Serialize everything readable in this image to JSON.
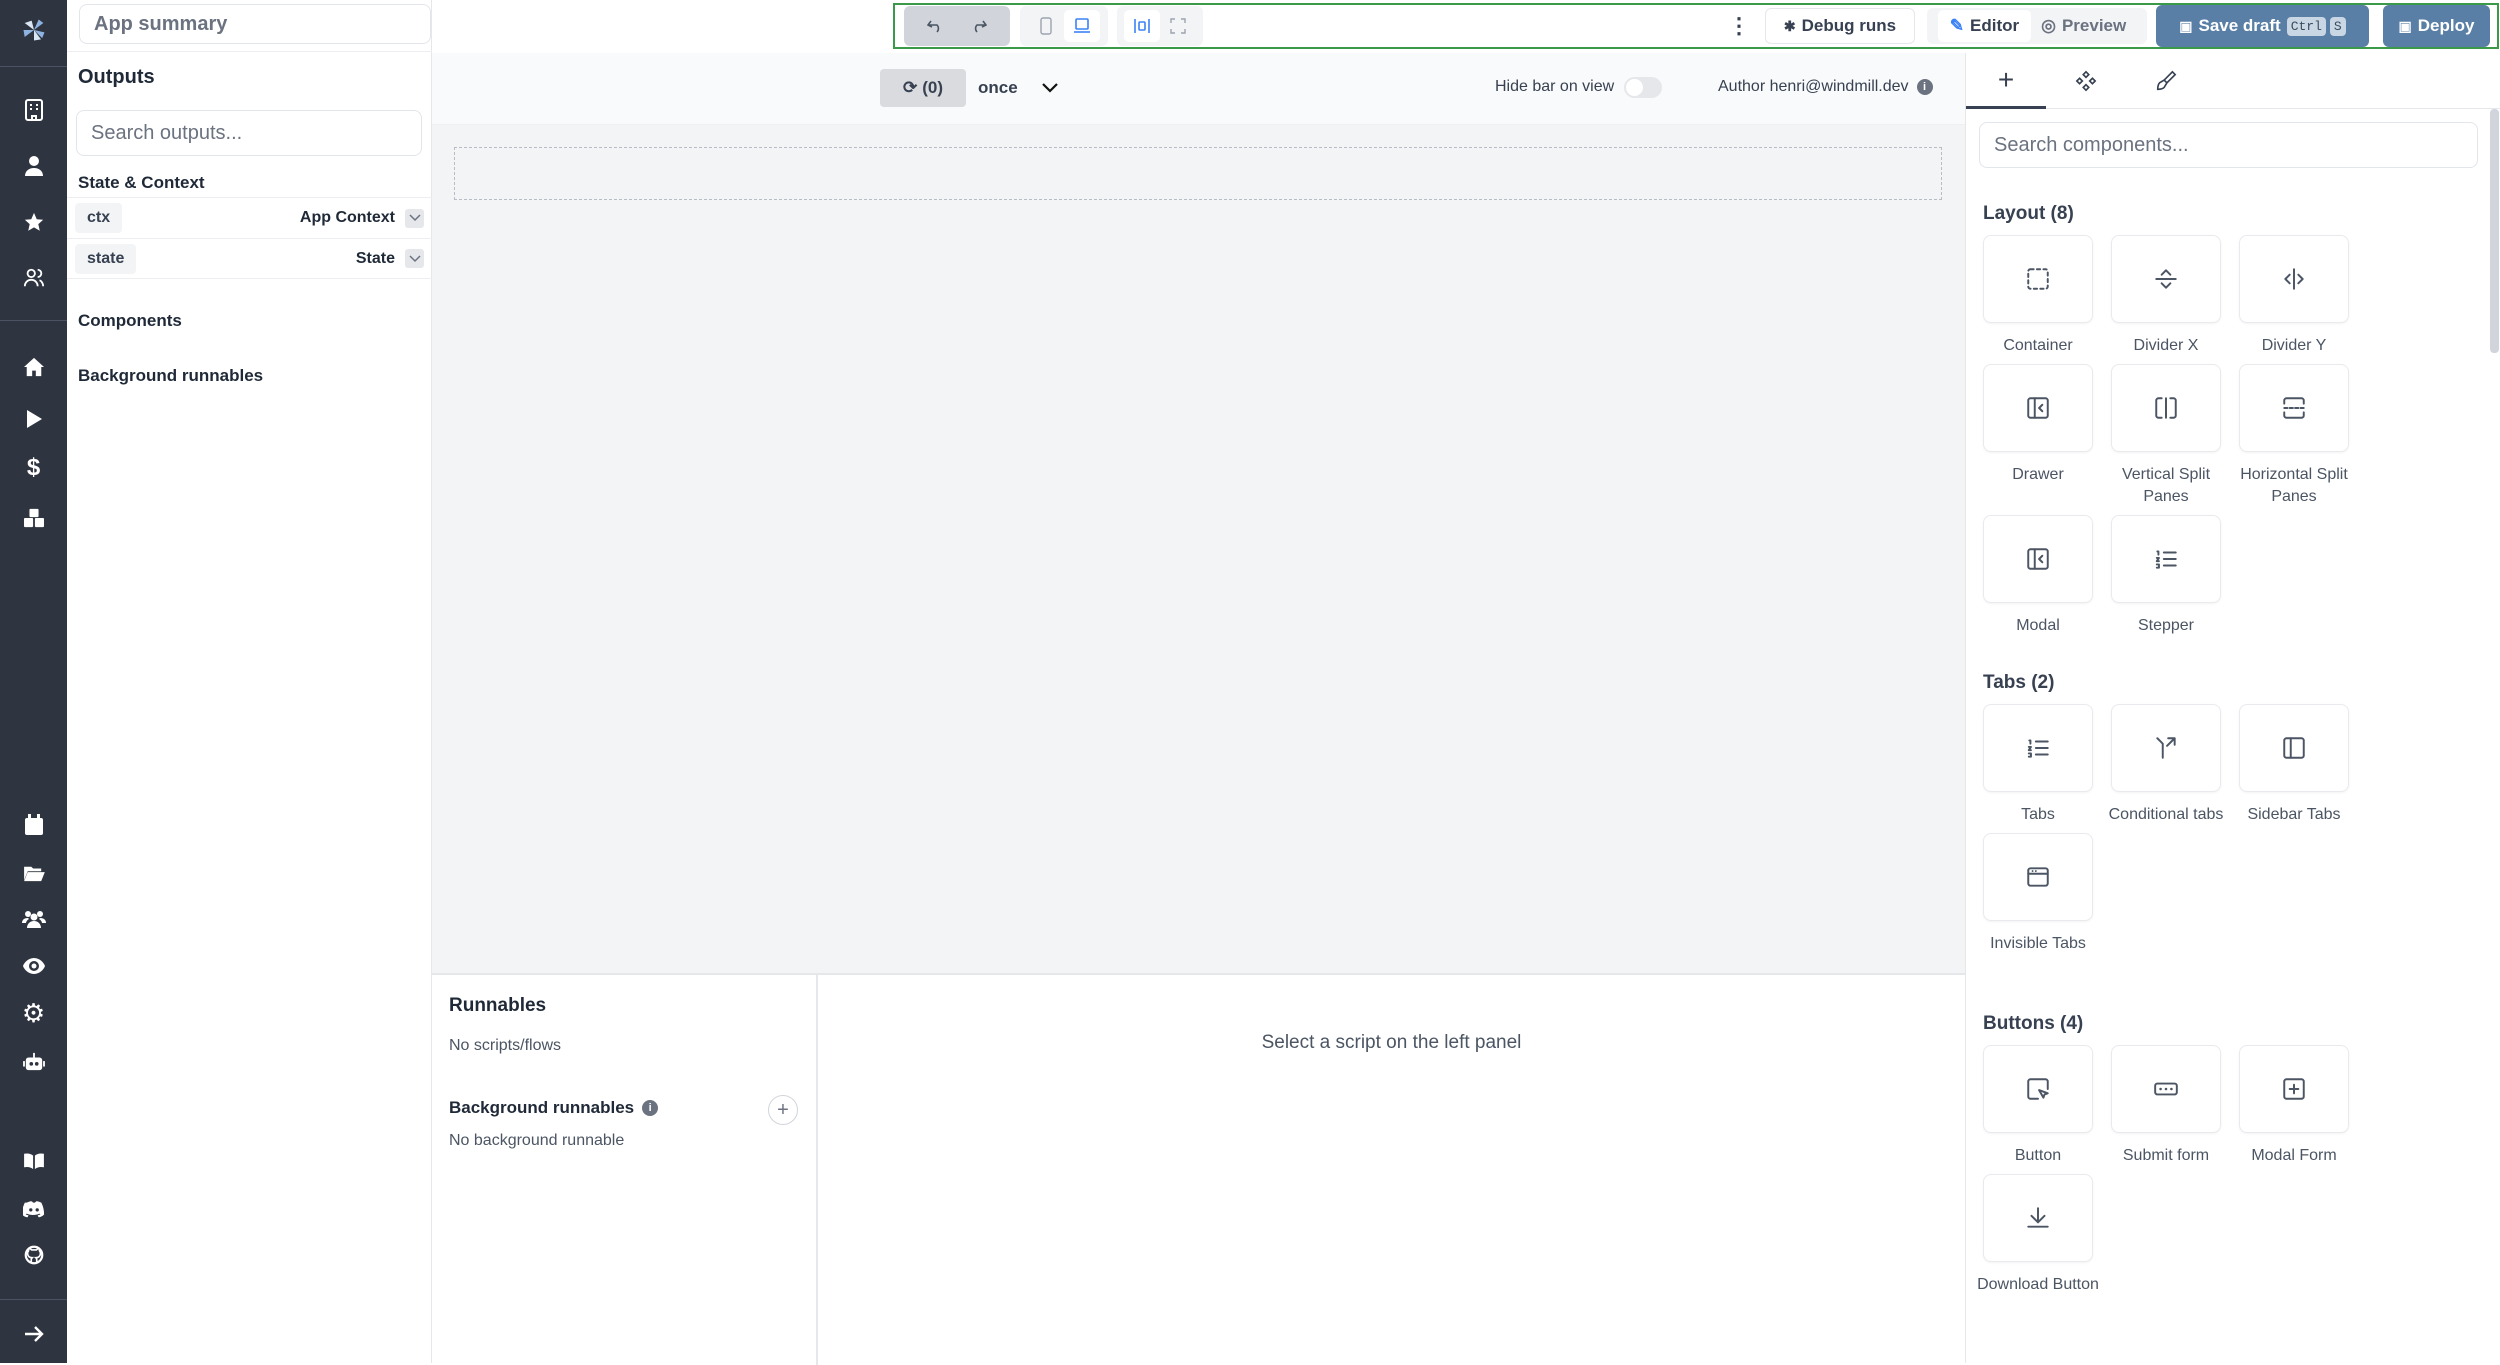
{
  "app_title_placeholder": "App summary",
  "left_panel": {
    "title": "Outputs",
    "search_placeholder": "Search outputs...",
    "state_context": "State & Context",
    "rows": [
      {
        "key": "ctx",
        "label": "App Context"
      },
      {
        "key": "state",
        "label": "State"
      }
    ],
    "components": "Components",
    "background_runnables": "Background runnables"
  },
  "toolbar": {
    "debug_runs": "Debug runs",
    "editor": "Editor",
    "preview": "Preview",
    "save_draft": "Save draft",
    "shortcut_ctrl": "Ctrl",
    "shortcut_s": "S",
    "deploy": "Deploy"
  },
  "subheader": {
    "refresh_count": "(0)",
    "refresh_mode": "once",
    "hide_bar": "Hide bar on view",
    "hide_bar_on": false,
    "author": "Author henri@windmill.dev"
  },
  "runnables": {
    "title": "Runnables",
    "empty": "No scripts/flows",
    "background_title": "Background runnables",
    "background_empty": "No background runnable",
    "select_hint": "Select a script on the left panel"
  },
  "right_panel": {
    "search_placeholder": "Search components...",
    "sections": [
      {
        "title": "Layout (8)",
        "items": [
          {
            "label": "Container",
            "icon": "dashed-square"
          },
          {
            "label": "Divider X",
            "icon": "divider-x"
          },
          {
            "label": "Divider Y",
            "icon": "divider-y"
          },
          {
            "label": "Drawer",
            "icon": "panel-left"
          },
          {
            "label": "Vertical Split Panes",
            "icon": "split-vertical"
          },
          {
            "label": "Horizontal Split Panes",
            "icon": "split-horizontal"
          },
          {
            "label": "Modal",
            "icon": "panel-left"
          },
          {
            "label": "Stepper",
            "icon": "list-ordered"
          }
        ]
      },
      {
        "title": "Tabs (2)",
        "items": [
          {
            "label": "Tabs",
            "icon": "list-ordered"
          },
          {
            "label": "Conditional tabs",
            "icon": "split-arrow"
          },
          {
            "label": "Sidebar Tabs",
            "icon": "sidebar"
          },
          {
            "label": "Invisible Tabs",
            "icon": "app-window"
          }
        ]
      },
      {
        "title": "Buttons (4)",
        "items": [
          {
            "label": "Button",
            "icon": "pointer-square"
          },
          {
            "label": "Submit form",
            "icon": "form-input"
          },
          {
            "label": "Modal Form",
            "icon": "plus-square"
          },
          {
            "label": "Download Button",
            "icon": "download"
          }
        ]
      }
    ]
  }
}
